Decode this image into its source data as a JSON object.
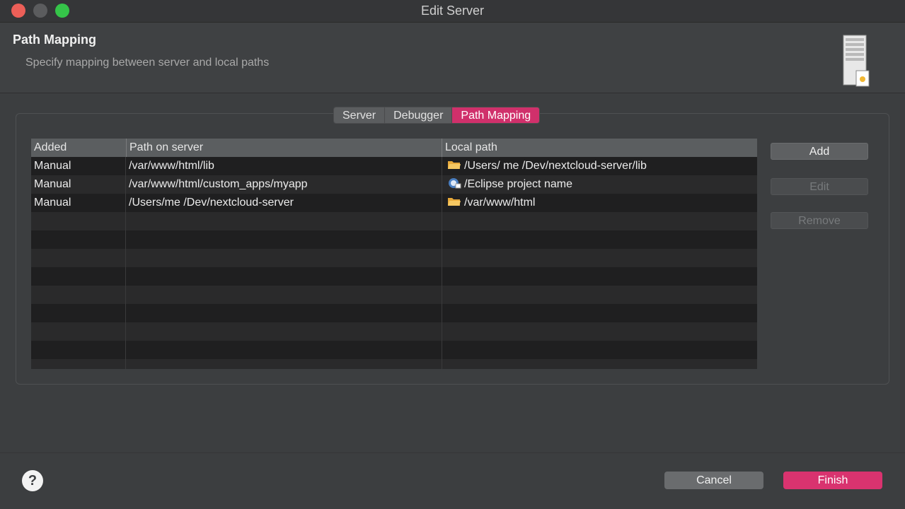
{
  "window": {
    "title": "Edit Server"
  },
  "header": {
    "title": "Path Mapping",
    "subtitle": "Specify mapping between server and local paths",
    "icon": "server-document-icon"
  },
  "tabs": [
    {
      "label": "Server",
      "active": false
    },
    {
      "label": "Debugger",
      "active": false
    },
    {
      "label": "Path Mapping",
      "active": true
    }
  ],
  "table": {
    "columns": [
      "Added",
      "Path on server",
      "Local path"
    ],
    "rows": [
      {
        "added": "Manual",
        "server_path": "/var/www/html/lib",
        "local_path": "/Users/ me /Dev/nextcloud-server/lib",
        "icon": "folder-icon"
      },
      {
        "added": "Manual",
        "server_path": "/var/www/html/custom_apps/myapp",
        "local_path": "/Eclipse project name",
        "icon": "eclipse-project-icon"
      },
      {
        "added": "Manual",
        "server_path": "/Users/me /Dev/nextcloud-server",
        "local_path": "/var/www/html",
        "icon": "folder-icon"
      }
    ]
  },
  "side_buttons": {
    "add": "Add",
    "edit": "Edit",
    "remove": "Remove"
  },
  "footer": {
    "cancel": "Cancel",
    "finish": "Finish",
    "help": "?"
  },
  "colors": {
    "accent": "#d9336f",
    "background": "#3c3e40",
    "table_bg": "#1e1e1f"
  }
}
